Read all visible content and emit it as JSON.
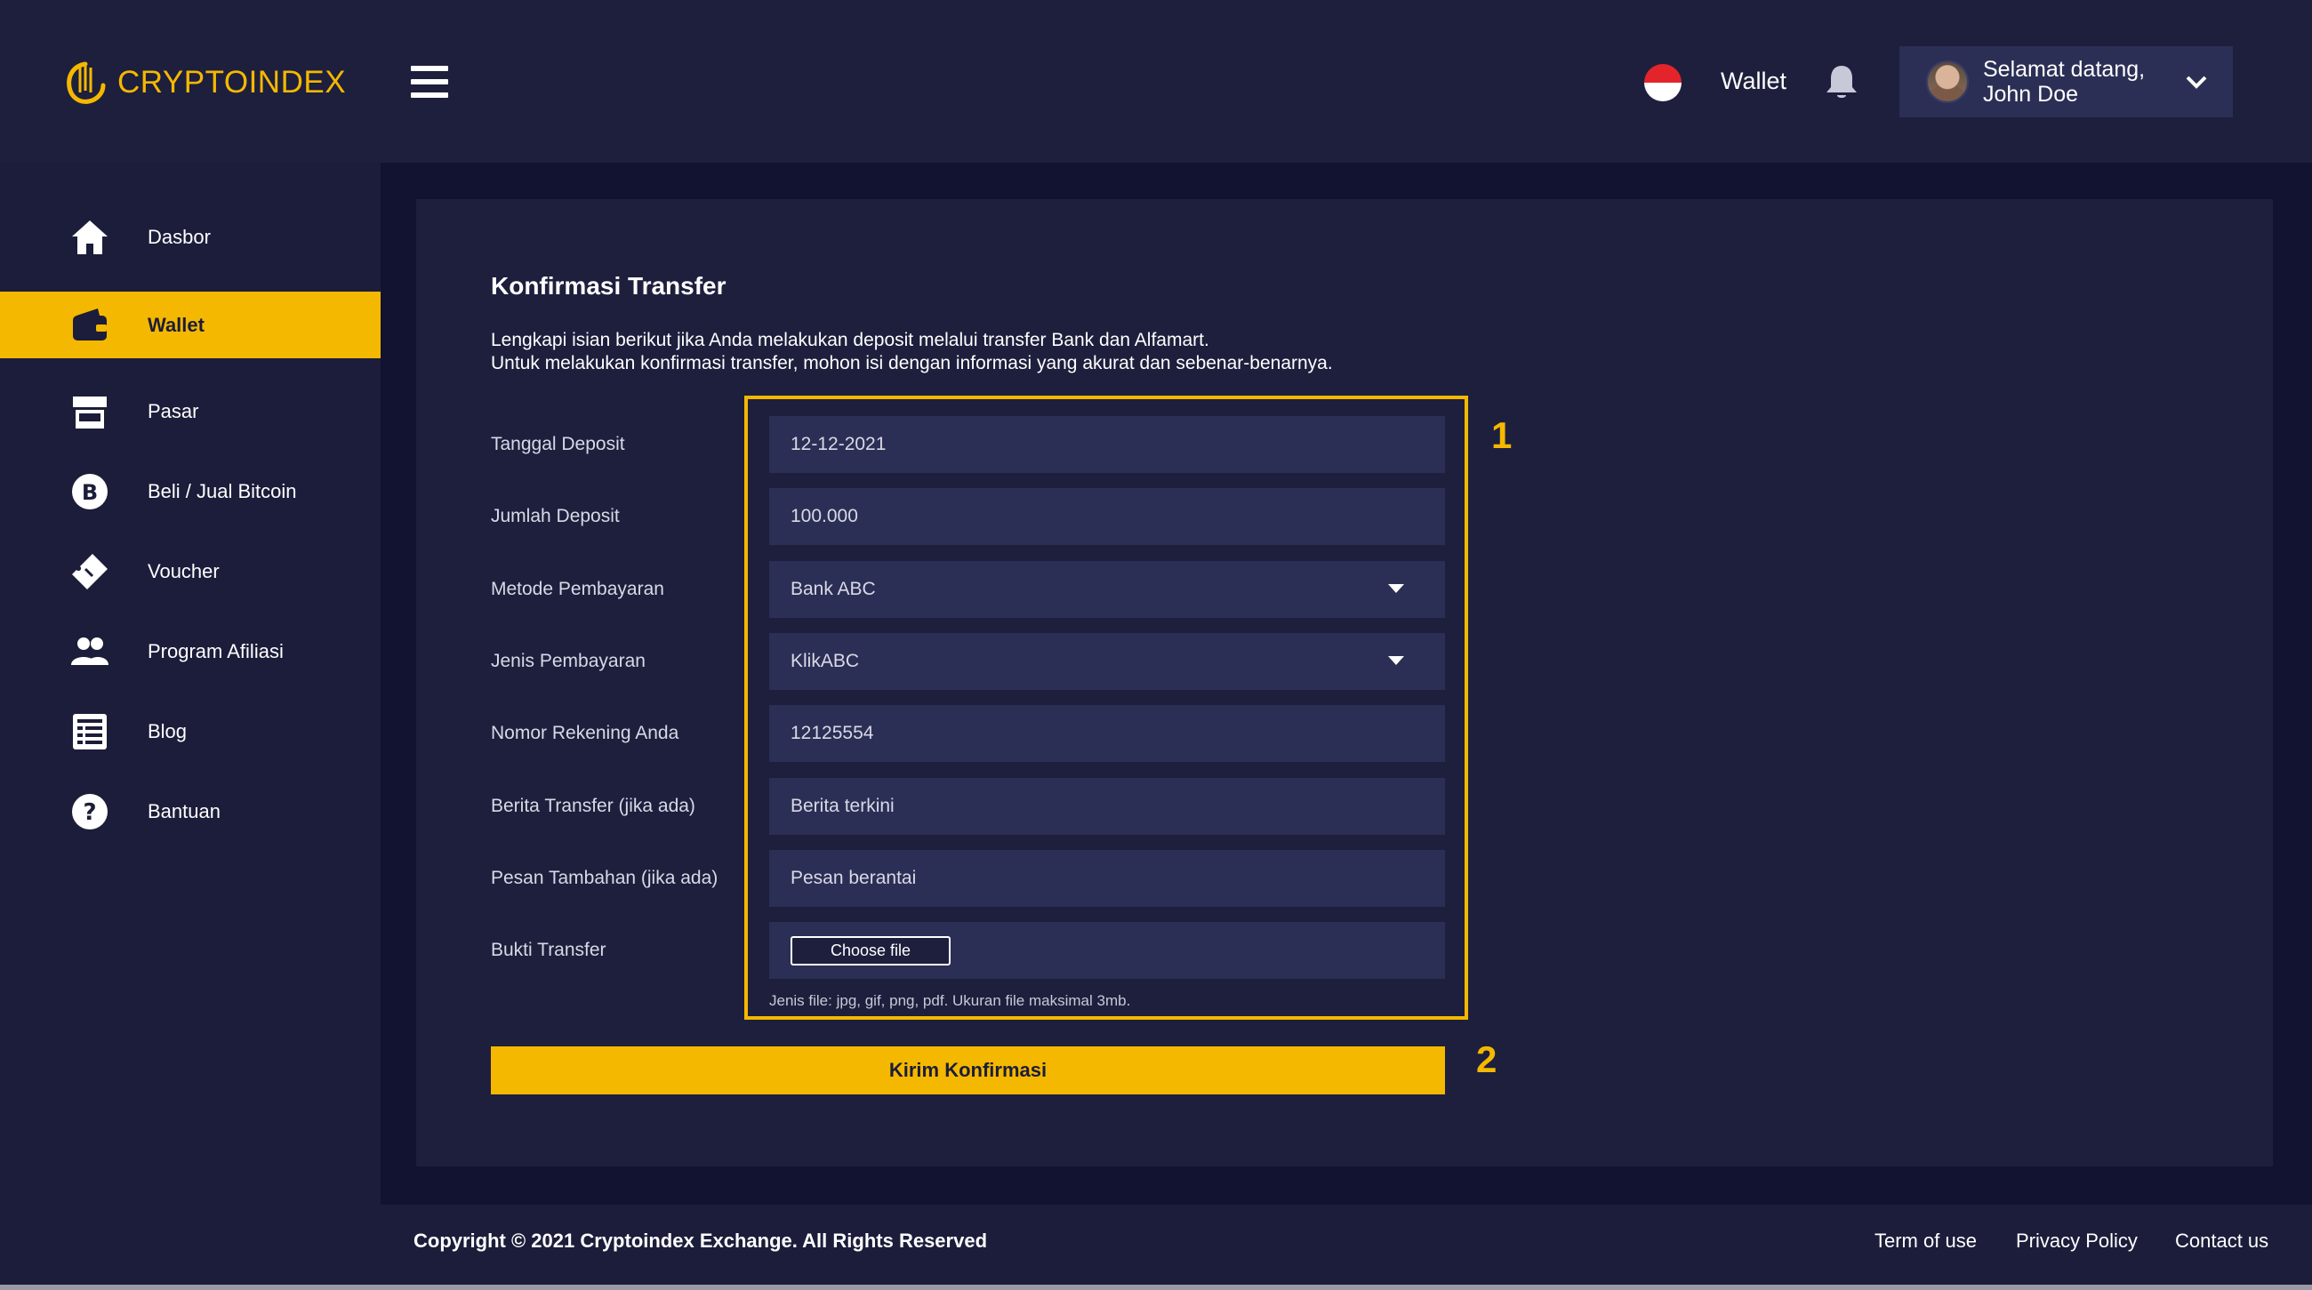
{
  "header": {
    "logo_text": "CRYPTOINDEX",
    "wallet_label": "Wallet",
    "greeting": "Selamat datang, John Doe",
    "icons": [
      "menu-icon",
      "flag-icon",
      "bell-icon",
      "avatar",
      "chevron-down-icon"
    ]
  },
  "sidebar": {
    "items": [
      {
        "label": "Dasbor",
        "icon": "home-icon"
      },
      {
        "label": "Wallet",
        "icon": "wallet-icon",
        "active": true
      },
      {
        "label": "Pasar",
        "icon": "store-icon"
      },
      {
        "label": "Beli / Jual Bitcoin",
        "icon": "bitcoin-icon"
      },
      {
        "label": "Voucher",
        "icon": "ticket-icon"
      },
      {
        "label": "Program Afiliasi",
        "icon": "users-icon"
      },
      {
        "label": "Blog",
        "icon": "list-icon"
      },
      {
        "label": "Bantuan",
        "icon": "help-icon"
      }
    ]
  },
  "main": {
    "title": "Konfirmasi Transfer",
    "intro_line1": "Lengkapi isian berikut jika Anda melakukan deposit melalui transfer Bank dan Alfamart.",
    "intro_line2": "Untuk melakukan konfirmasi transfer, mohon isi dengan informasi yang akurat dan sebenar-benarnya.",
    "form": {
      "tanggal_label": "Tanggal Deposit",
      "tanggal_value": "12-12-2021",
      "jumlah_label": "Jumlah Deposit",
      "jumlah_value": "100.000",
      "metode_label": "Metode Pembayaran",
      "metode_value": "Bank ABC",
      "jenis_label": "Jenis Pembayaran",
      "jenis_value": "KlikABC",
      "rekening_label": "Nomor Rekening Anda",
      "rekening_value": "12125554",
      "berita_label": "Berita Transfer (jika ada)",
      "berita_value": "Berita terkini",
      "pesan_label": "Pesan Tambahan (jika ada)",
      "pesan_value": "Pesan berantai",
      "bukti_label": "Bukti Transfer",
      "choose_file_label": "Choose file",
      "file_hint": "Jenis file: jpg, gif, png, pdf. Ukuran file maksimal 3mb."
    },
    "submit_label": "Kirim Konfirmasi",
    "marker_1": "1",
    "marker_2": "2"
  },
  "footer": {
    "copyright": "Copyright © 2021 Cryptoindex Exchange. All Rights Reserved",
    "links": [
      "Term of use",
      "Privacy Policy",
      "Contact us"
    ]
  },
  "colors": {
    "accent": "#f5b800",
    "background": "#1b1d3a",
    "content_bg": "#121330",
    "field_bg": "#2c2f55"
  }
}
